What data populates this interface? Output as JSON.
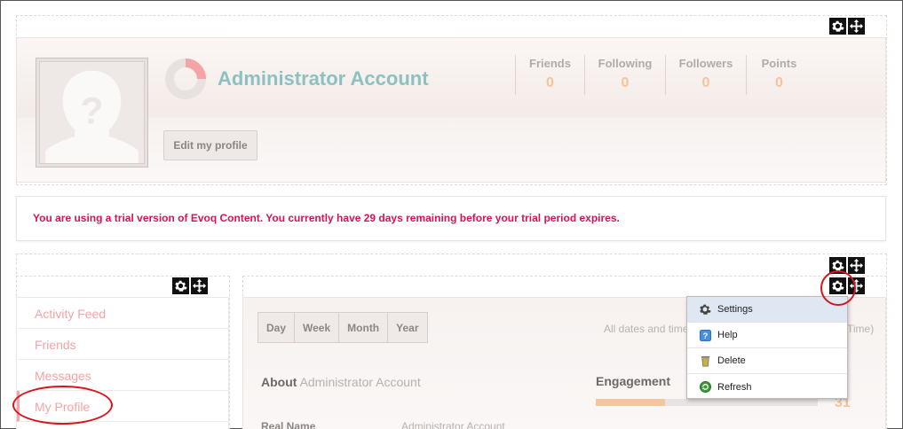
{
  "profile": {
    "name": "Administrator Account",
    "edit_label": "Edit my profile",
    "stats": [
      {
        "label": "Friends",
        "value": "0"
      },
      {
        "label": "Following",
        "value": "0"
      },
      {
        "label": "Followers",
        "value": "0"
      },
      {
        "label": "Points",
        "value": "0"
      }
    ]
  },
  "banner": {
    "text": "You are using a trial version of Evoq Content. You currently have 29 days remaining before your trial period expires."
  },
  "nav": {
    "items": [
      "Activity Feed",
      "Friends",
      "Messages",
      "My Profile"
    ]
  },
  "main": {
    "ranges": [
      "Day",
      "Week",
      "Month",
      "Year"
    ],
    "dates_note_left": "All dates and time",
    "dates_note_right": "Time)",
    "about_prefix": "About",
    "about_name": "Administrator Account",
    "engagement_label": "Engagement",
    "engagement_score": "31",
    "real_name_label": "Real Name",
    "real_name_value": "Administrator Account"
  },
  "menu": {
    "items": [
      {
        "label": "Settings",
        "icon": "gear-icon"
      },
      {
        "label": "Help",
        "icon": "help-icon"
      },
      {
        "label": "Delete",
        "icon": "trash-icon"
      },
      {
        "label": "Refresh",
        "icon": "refresh-icon"
      }
    ]
  },
  "colors": {
    "accent_name": "#8cc0c1",
    "stat_value": "#f4c39c",
    "nav_text": "#f5a3a6",
    "banner_text": "#d3145a",
    "highlight_ring": "#d8141c"
  }
}
